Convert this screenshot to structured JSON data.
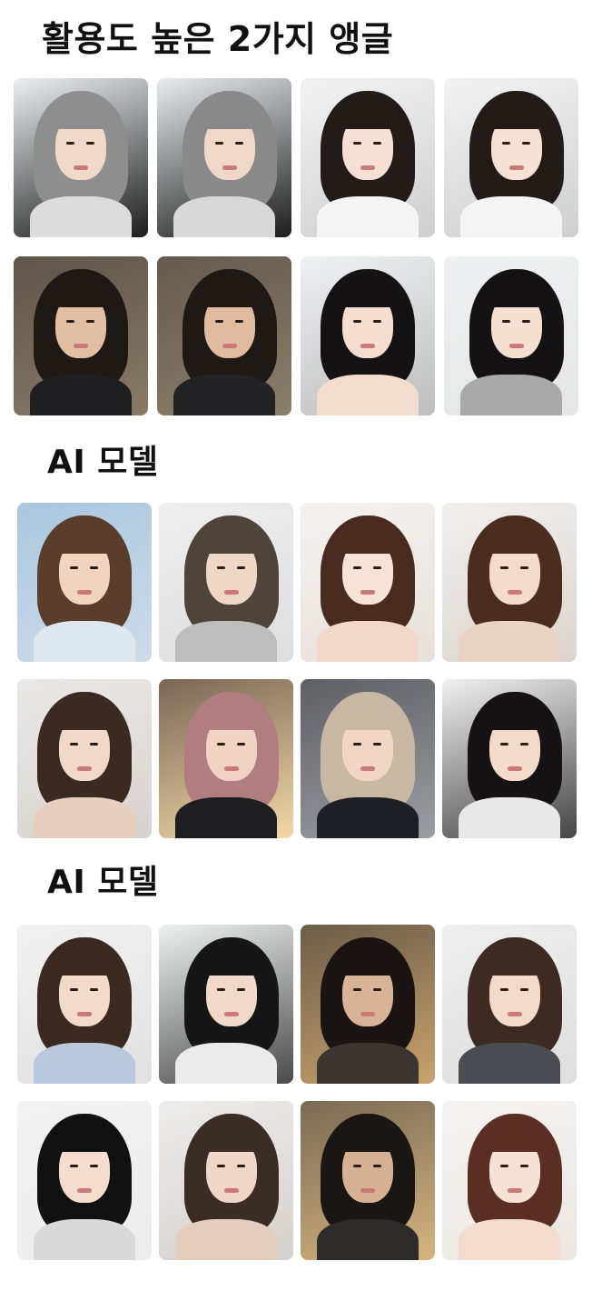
{
  "sections": [
    {
      "title": "활용도 높은 2가지 앵글"
    },
    {
      "title": "AI 모델"
    },
    {
      "title": "AI 모델"
    }
  ],
  "photos": [
    {
      "name": "photo-man-gray-hair-hoodie-front",
      "bg": "#eceeef",
      "hair": "#8e8e8e",
      "skin": "#f1d9c9",
      "clothes": "#dcdcdc",
      "accent": "#1c1c1c"
    },
    {
      "name": "photo-man-gray-hair-hoodie-side",
      "bg": "#e9ebec",
      "hair": "#8a8a8a",
      "skin": "#f0d8c8",
      "clothes": "#d8d8d8",
      "accent": "#1c1c1c"
    },
    {
      "name": "photo-woman-dark-wavy-hair-white-shirt-front",
      "bg": "#f2f2f2",
      "hair": "#231b17",
      "skin": "#f5e0d3",
      "clothes": "#f4f4f4",
      "accent": "#cfcfcf"
    },
    {
      "name": "photo-woman-dark-wavy-hair-white-shirt-side",
      "bg": "#f2f2f2",
      "hair": "#231b17",
      "skin": "#f6e1d4",
      "clothes": "#f4f4f4",
      "accent": "#cfcfcf"
    },
    {
      "name": "photo-man-curly-hair-black-sweater-cafe",
      "bg": "#5e5448",
      "hair": "#1e1915",
      "skin": "#e2bea3",
      "clothes": "#1f1f21",
      "accent": "#8a7b68"
    },
    {
      "name": "photo-man-curly-hair-black-sweater-phone",
      "bg": "#655a4d",
      "hair": "#1e1915",
      "skin": "#e0bb9f",
      "clothes": "#232325",
      "accent": "#8d7e6b"
    },
    {
      "name": "photo-woman-long-black-hair-bangs-front",
      "bg": "#eef0f1",
      "hair": "#141212",
      "skin": "#f5ded0",
      "clothes": "#f1dccd",
      "accent": "#bdbdbd"
    },
    {
      "name": "photo-woman-long-black-hair-bangs-side",
      "bg": "#eef0f1",
      "hair": "#141212",
      "skin": "#f5dfd1",
      "clothes": "#a9a9a9",
      "accent": "#e6e6e6"
    },
    {
      "name": "photo-woman-brown-bob-sky",
      "bg": "#a9c7de",
      "hair": "#5a3e2b",
      "skin": "#f1d4c0",
      "clothes": "#dfe7ee",
      "accent": "#cfdcea"
    },
    {
      "name": "photo-woman-short-ash-brown-hair",
      "bg": "#eeeeee",
      "hair": "#4e4439",
      "skin": "#f0d6c4",
      "clothes": "#bdbdbd",
      "accent": "#dedede"
    },
    {
      "name": "photo-woman-dark-brown-low-bun",
      "bg": "#f4f2f0",
      "hair": "#4a2b20",
      "skin": "#f7e2d6",
      "clothes": "#f1d8c8",
      "accent": "#e8e0da"
    },
    {
      "name": "photo-woman-long-brown-curls-smile",
      "bg": "#f1efed",
      "hair": "#4b2d20",
      "skin": "#f3dacb",
      "clothes": "#e9d3c5",
      "accent": "#dcd4ce"
    },
    {
      "name": "photo-woman-long-wavy-brown-bangs",
      "bg": "#eae8e6",
      "hair": "#3a2a21",
      "skin": "#f1d8c8",
      "clothes": "#e7cfbf",
      "accent": "#d8d2cd"
    },
    {
      "name": "photo-woman-rose-pink-curls-salon",
      "bg": "#7a6656",
      "hair": "#b07d80",
      "skin": "#f0d3c3",
      "clothes": "#1e1e22",
      "accent": "#f3d9a6"
    },
    {
      "name": "photo-woman-ash-blonde-layers-salon",
      "bg": "#5d5f63",
      "hair": "#c8b8a3",
      "skin": "#f1d6c6",
      "clothes": "#1e2026",
      "accent": "#9b9ea4"
    },
    {
      "name": "photo-woman-black-layered-hair-profile",
      "bg": "#f1f1f1",
      "hair": "#151313",
      "skin": "#f3dacb",
      "clothes": "#e8e8e8",
      "accent": "#444444"
    },
    {
      "name": "photo-woman-brown-layered-bangs-blue-top",
      "bg": "#f1f1f1",
      "hair": "#3b2a20",
      "skin": "#f2d9c9",
      "clothes": "#b9c8dc",
      "accent": "#e1e1e1"
    },
    {
      "name": "photo-woman-black-wavy-hair-striped-shirt",
      "bg": "#eff0f0",
      "hair": "#171616",
      "skin": "#f2d8c8",
      "clothes": "#ebebeb",
      "accent": "#4a4a4a"
    },
    {
      "name": "photo-man-curly-hair-back-salon",
      "bg": "#6c5c49",
      "hair": "#1a1512",
      "skin": "#d9b396",
      "clothes": "#3c3630",
      "accent": "#c9a36d"
    },
    {
      "name": "photo-woman-brown-bob-bangs",
      "bg": "#eeeeee",
      "hair": "#3d2a20",
      "skin": "#f3d9c9",
      "clothes": "#4a4d52",
      "accent": "#dedede"
    },
    {
      "name": "photo-woman-black-hime-cut-offshoulder",
      "bg": "#f2f2f2",
      "hair": "#121111",
      "skin": "#f4ddcf",
      "clothes": "#d9d9d9",
      "accent": "#ececec"
    },
    {
      "name": "photo-woman-long-wavy-dark-hair-bangs",
      "bg": "#ececec",
      "hair": "#3b2d25",
      "skin": "#f0d6c6",
      "clothes": "#e4cdbf",
      "accent": "#d6d0cb"
    },
    {
      "name": "photo-man-curly-hair-back-salon-2",
      "bg": "#7a6a55",
      "hair": "#1a1613",
      "skin": "#d7b194",
      "clothes": "#2e2b29",
      "accent": "#d6b47f"
    },
    {
      "name": "photo-woman-reddish-brown-ponytail-hand",
      "bg": "#f5f3f1",
      "hair": "#5a2e22",
      "skin": "#f7e1d5",
      "clothes": "#f3dccd",
      "accent": "#ece6e1"
    }
  ]
}
